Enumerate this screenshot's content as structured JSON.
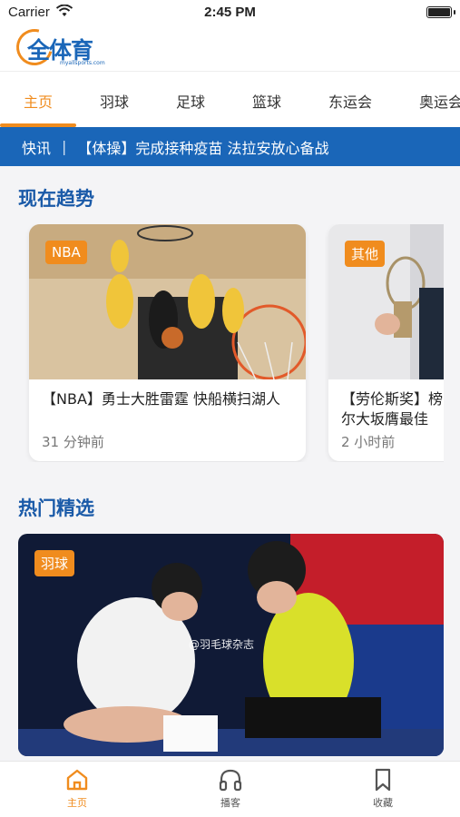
{
  "status_bar": {
    "carrier": "Carrier",
    "time": "2:45 PM"
  },
  "header": {
    "logo_text": "全体育",
    "logo_sub": "myallsports.com"
  },
  "tabs": [
    {
      "label": "主页",
      "active": true
    },
    {
      "label": "羽球"
    },
    {
      "label": "足球"
    },
    {
      "label": "篮球"
    },
    {
      "label": "东运会"
    },
    {
      "label": "奥运会"
    }
  ],
  "ticker": {
    "label": "快讯",
    "separator": "|",
    "text": "【体操】完成接种疫苗 法拉安放心备战"
  },
  "trending": {
    "title": "现在趋势",
    "cards": [
      {
        "badge": "NBA",
        "title": "【NBA】勇士大胜雷霆 快船横扫湖人",
        "time": "31 分钟前"
      },
      {
        "badge": "其他",
        "title": "【劳伦斯奖】榜\n尔大坂膺最佳",
        "time": "2 小时前"
      }
    ]
  },
  "featured": {
    "title": "热门精选",
    "badge": "羽球",
    "watermark": "@羽毛球杂志"
  },
  "bottom_nav": [
    {
      "label": "主页",
      "icon": "home-icon",
      "active": true
    },
    {
      "label": "播客",
      "icon": "headphones-icon"
    },
    {
      "label": "收藏",
      "icon": "bookmark-icon"
    }
  ],
  "colors": {
    "accent": "#f08c1e",
    "brand_blue": "#1a66b8"
  }
}
